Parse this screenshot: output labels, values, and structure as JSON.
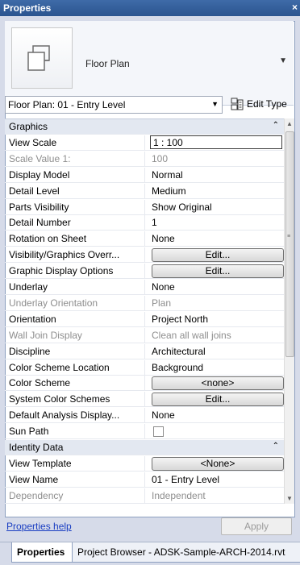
{
  "window": {
    "title": "Properties",
    "close": "×"
  },
  "type_selector": {
    "name": "Floor Plan"
  },
  "instance_selector": {
    "value": "Floor Plan: 01 - Entry Level"
  },
  "edit_type": {
    "label": "Edit Type"
  },
  "rows": [
    {
      "kind": "group",
      "name": "Graphics"
    },
    {
      "kind": "input",
      "name": "View Scale",
      "value": "1 : 100"
    },
    {
      "kind": "text",
      "name": "Scale Value    1:",
      "value": "100",
      "dim": true
    },
    {
      "kind": "text",
      "name": "Display Model",
      "value": "Normal"
    },
    {
      "kind": "text",
      "name": "Detail Level",
      "value": "Medium"
    },
    {
      "kind": "text",
      "name": "Parts Visibility",
      "value": "Show Original"
    },
    {
      "kind": "text",
      "name": "Detail Number",
      "value": "1"
    },
    {
      "kind": "text",
      "name": "Rotation on Sheet",
      "value": "None"
    },
    {
      "kind": "button",
      "name": "Visibility/Graphics Overr...",
      "value": "Edit..."
    },
    {
      "kind": "button",
      "name": "Graphic Display Options",
      "value": "Edit..."
    },
    {
      "kind": "text",
      "name": "Underlay",
      "value": "None"
    },
    {
      "kind": "text",
      "name": "Underlay Orientation",
      "value": "Plan",
      "dim": true
    },
    {
      "kind": "text",
      "name": "Orientation",
      "value": "Project North"
    },
    {
      "kind": "text",
      "name": "Wall Join Display",
      "value": "Clean all wall joins",
      "dim": true
    },
    {
      "kind": "text",
      "name": "Discipline",
      "value": "Architectural"
    },
    {
      "kind": "text",
      "name": "Color Scheme Location",
      "value": "Background"
    },
    {
      "kind": "button",
      "name": "Color Scheme",
      "value": "<none>"
    },
    {
      "kind": "button",
      "name": "System Color Schemes",
      "value": "Edit..."
    },
    {
      "kind": "text",
      "name": "Default Analysis Display...",
      "value": "None"
    },
    {
      "kind": "checkbox",
      "name": "Sun Path",
      "value": ""
    },
    {
      "kind": "group",
      "name": "Identity Data"
    },
    {
      "kind": "button",
      "name": "View Template",
      "value": "<None>"
    },
    {
      "kind": "text",
      "name": "View Name",
      "value": "01 - Entry Level"
    },
    {
      "kind": "text",
      "name": "Dependency",
      "value": "Independent",
      "dim": true
    }
  ],
  "footer": {
    "help_link": "Properties help",
    "apply": "Apply"
  },
  "tabs": {
    "active": "Properties",
    "other": "Project Browser - ADSK-Sample-ARCH-2014.rvt"
  }
}
